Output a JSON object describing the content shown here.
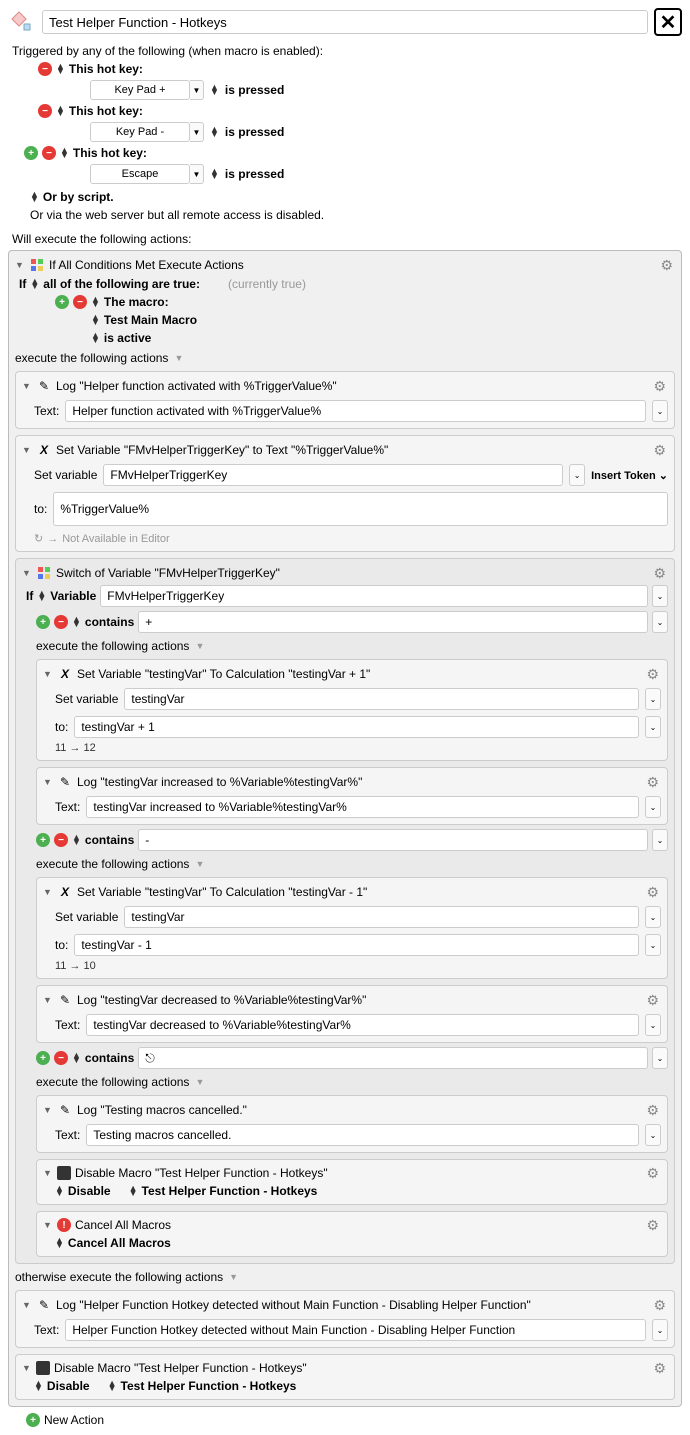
{
  "title": "Test Helper Function - Hotkeys",
  "triggers_label": "Triggered by any of the following (when macro is enabled):",
  "hotkey_label": "This hot key:",
  "is_pressed": "is pressed",
  "or_by_script": "Or by script.",
  "web_server": "Or via the web server but all remote access is disabled.",
  "keys": {
    "k1": "Key Pad +",
    "k2": "Key Pad -",
    "k3": "Escape"
  },
  "actions_label": "Will execute the following actions:",
  "if_all": {
    "title": "If All Conditions Met Execute Actions",
    "if": "If",
    "all_true": "all of the following are true:",
    "currently_true": "(currently true)",
    "the_macro": "The macro:",
    "macro_name": "Test Main Macro",
    "is_active": "is active",
    "exec_label": "execute the following actions",
    "otherwise_label": "otherwise execute the following actions"
  },
  "log1": {
    "title": "Log \"Helper function activated with %TriggerValue%\"",
    "label": "Text:",
    "value": "Helper function activated with %TriggerValue%"
  },
  "setvar1": {
    "title": "Set Variable \"FMvHelperTriggerKey\" to Text \"%TriggerValue%\"",
    "label1": "Set variable",
    "value1": "FMvHelperTriggerKey",
    "insert": "Insert Token",
    "label2": "to:",
    "value2": "%TriggerValue%",
    "not_avail": "Not Available in Editor"
  },
  "switch": {
    "title": "Switch of Variable \"FMvHelperTriggerKey\"",
    "if": "If",
    "variable": "Variable",
    "varname": "FMvHelperTriggerKey",
    "contains": "contains",
    "c1": "+",
    "c2": "-",
    "c3": "⎋",
    "exec": "execute the following actions"
  },
  "sv_inc": {
    "title": "Set Variable \"testingVar\" To Calculation \"testingVar + 1\"",
    "label1": "Set variable",
    "value1": "testingVar",
    "label2": "to:",
    "value2": "testingVar + 1",
    "note": "11 → 12"
  },
  "log_inc": {
    "title": "Log \"testingVar increased to %Variable%testingVar%\"",
    "label": "Text:",
    "value": "testingVar increased to %Variable%testingVar%"
  },
  "sv_dec": {
    "title": "Set Variable \"testingVar\" To Calculation \"testingVar - 1\"",
    "label1": "Set variable",
    "value1": "testingVar",
    "label2": "to:",
    "value2": "testingVar - 1",
    "note": "11 → 10"
  },
  "log_dec": {
    "title": "Log \"testingVar decreased to %Variable%testingVar%\"",
    "label": "Text:",
    "value": "testingVar decreased to %Variable%testingVar%"
  },
  "log_cancel": {
    "title": "Log \"Testing macros cancelled.\"",
    "label": "Text:",
    "value": "Testing macros cancelled."
  },
  "disable1": {
    "title": "Disable Macro \"Test Helper Function - Hotkeys\"",
    "action": "Disable",
    "target": "Test Helper Function - Hotkeys"
  },
  "cancel_all": {
    "title": "Cancel All Macros",
    "action": "Cancel All Macros"
  },
  "log_else": {
    "title": "Log \"Helper Function Hotkey detected without Main Function - Disabling Helper Function\"",
    "label": "Text:",
    "value": "Helper Function Hotkey detected without Main Function - Disabling Helper Function"
  },
  "disable2": {
    "title": "Disable Macro \"Test Helper Function - Hotkeys\"",
    "action": "Disable",
    "target": "Test Helper Function - Hotkeys"
  },
  "new_action": "New Action"
}
